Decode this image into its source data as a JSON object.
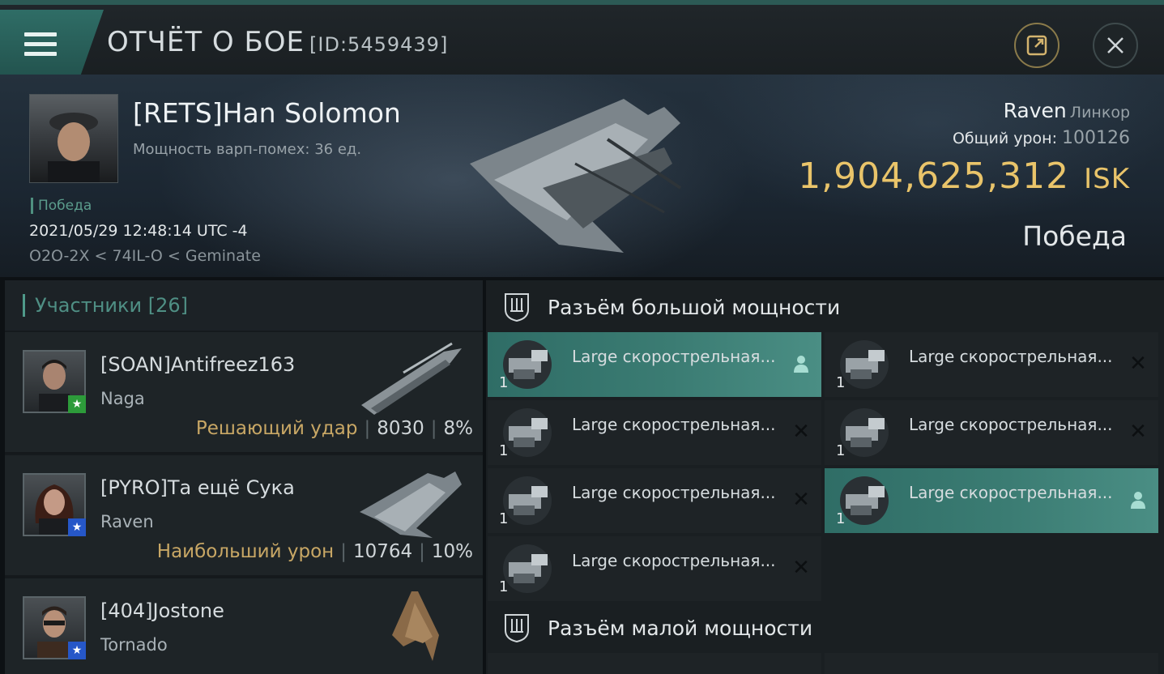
{
  "header": {
    "title": "ОТЧЁТ О БОЕ",
    "report_id": "[ID:5459439]",
    "menu_icon": "hamburger-menu-icon",
    "share_icon": "external-link-icon",
    "close_icon": "close-icon"
  },
  "victim": {
    "name": "[RETS]Han Solomon",
    "warp_disruption": "Мощность варп-помех: 36 ед.",
    "status_small": "Победа",
    "datetime": "2021/05/29 12:48:14 UTC -4",
    "location": "O2O-2X < 74IL-O < Geminate",
    "ship_name": "Raven",
    "ship_class": "Линкор",
    "total_damage_label": "Общий урон:",
    "total_damage": "100126",
    "isk_value": "1,904,625,312",
    "isk_unit": "ISK",
    "result": "Победа"
  },
  "participants": {
    "label": "Участники",
    "count": "[26]",
    "rows": [
      {
        "name": "[SOAN]Antifreez163",
        "ship": "Naga",
        "tag": "Решающий удар",
        "damage": "8030",
        "percent": "8%",
        "badge_color": "#2d9b3a"
      },
      {
        "name": "[PYRO]Та ещё Сука",
        "ship": "Raven",
        "tag": "Наибольший урон",
        "damage": "10764",
        "percent": "10%",
        "badge_color": "#2657c8"
      },
      {
        "name": "[404]Jostone",
        "ship": "Tornado",
        "tag": "",
        "damage": "",
        "percent": "",
        "badge_color": "#2657c8"
      }
    ]
  },
  "slots": {
    "high_title": "Разъём большой мощности",
    "low_title": "Разъём малой мощности",
    "high": [
      {
        "name": "Large скорострельная...",
        "qty": "1",
        "fitted": true
      },
      {
        "name": "Large скорострельная...",
        "qty": "1",
        "fitted": false
      },
      {
        "name": "Large скорострельная...",
        "qty": "1",
        "fitted": false
      },
      {
        "name": "Large скорострельная...",
        "qty": "1",
        "fitted": false
      },
      {
        "name": "Large скорострельная...",
        "qty": "1",
        "fitted": false
      },
      {
        "name": "Large скорострельная...",
        "qty": "1",
        "fitted": true
      },
      {
        "name": "Large скорострельная...",
        "qty": "1",
        "fitted": false
      }
    ]
  },
  "colors": {
    "accent_teal": "#2f6d66",
    "isk_gold": "#e9c46a",
    "tag_gold": "#c8a765"
  }
}
